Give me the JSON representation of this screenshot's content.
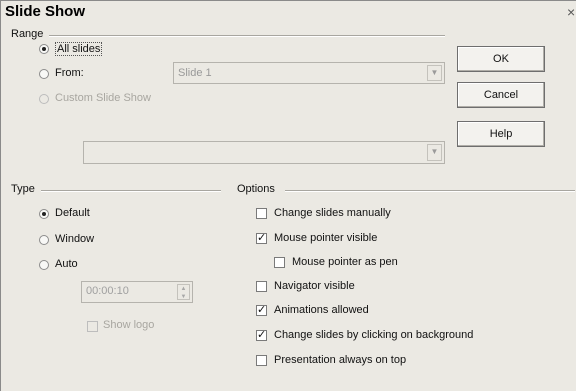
{
  "window": {
    "title": "Slide Show",
    "close_glyph": "×"
  },
  "range": {
    "label": "Range",
    "all_slides": "All slides",
    "from": "From:",
    "from_value": "Slide 1",
    "custom": "Custom Slide Show",
    "custom_value": "",
    "selected": "all_slides"
  },
  "type": {
    "label": "Type",
    "default": "Default",
    "window": "Window",
    "auto": "Auto",
    "selected": "default",
    "pause_value": "00:00:10",
    "show_logo": "Show logo"
  },
  "options": {
    "label": "Options",
    "items": [
      {
        "label": "Change slides manually",
        "checked": false
      },
      {
        "label": "Mouse pointer visible",
        "checked": true
      },
      {
        "label": "Mouse pointer as pen",
        "checked": false
      },
      {
        "label": "Navigator visible",
        "checked": false
      },
      {
        "label": "Animations allowed",
        "checked": true
      },
      {
        "label": "Change slides by clicking on background",
        "checked": true
      },
      {
        "label": "Presentation always on top",
        "checked": false
      }
    ]
  },
  "buttons": {
    "ok": "OK",
    "cancel": "Cancel",
    "help": "Help"
  },
  "icons": {
    "dropdown": "chevron-down-icon",
    "spin": "spin-arrows-icon",
    "close": "close-icon"
  }
}
